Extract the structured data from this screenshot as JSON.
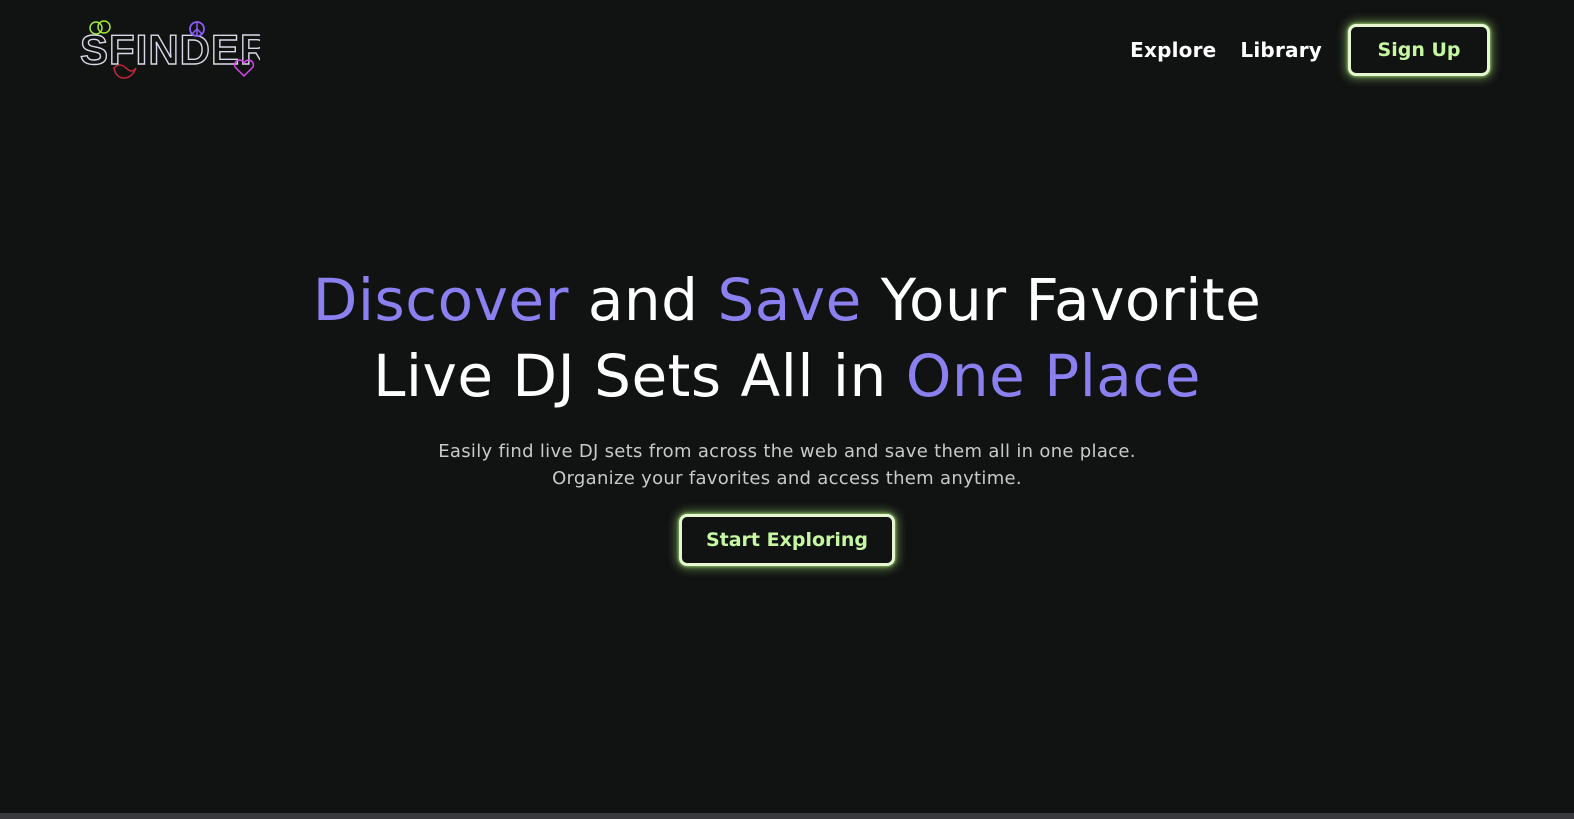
{
  "logo": {
    "text": "SFINDER",
    "colors": {
      "outline": "#d8d8e8",
      "purple": "#8b5cf6",
      "green": "#a3e635",
      "red": "#c0283c",
      "pink": "#d946ef"
    }
  },
  "nav": {
    "links": [
      {
        "label": "Explore"
      },
      {
        "label": "Library"
      }
    ],
    "signup_label": "Sign Up"
  },
  "hero": {
    "title_line1": {
      "part1": "Discover",
      "part2": " and ",
      "part3": "Save",
      "part4": " Your Favorite"
    },
    "title_line2": {
      "part1": "Live DJ Sets All in ",
      "part2": "One Place"
    },
    "subtitle": "Easily find live DJ sets from across the web and save them all in one place. Organize your favorites and access them anytime.",
    "cta_label": "Start Exploring"
  },
  "colors": {
    "background": "#111212",
    "accent": "#8b80f0",
    "button_text": "#c6f7a2",
    "button_glow": "#b5f782"
  }
}
